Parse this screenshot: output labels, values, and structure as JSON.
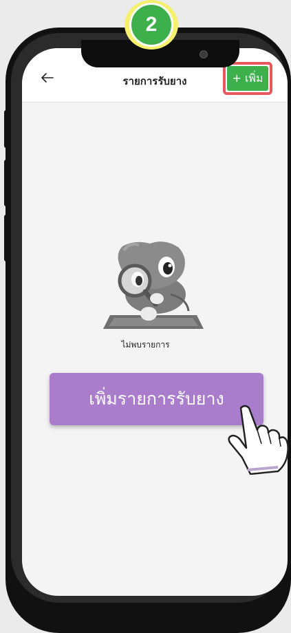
{
  "step_badge": "2",
  "header": {
    "title": "รายการรับยาง",
    "add_button_label": "+ เพิ่ม"
  },
  "empty_state": {
    "message": "ไม่พบรายการ"
  },
  "primary_action": {
    "label": "เพิ่มรายการรับยาง"
  },
  "colors": {
    "add_button": "#3db04b",
    "highlight": "#e8585f",
    "primary_button": "#a97ccc",
    "step_badge_ring": "#f5f06e"
  },
  "icons": [
    "back-arrow-icon",
    "mascot-magnifier-icon",
    "pointing-hand-icon"
  ]
}
